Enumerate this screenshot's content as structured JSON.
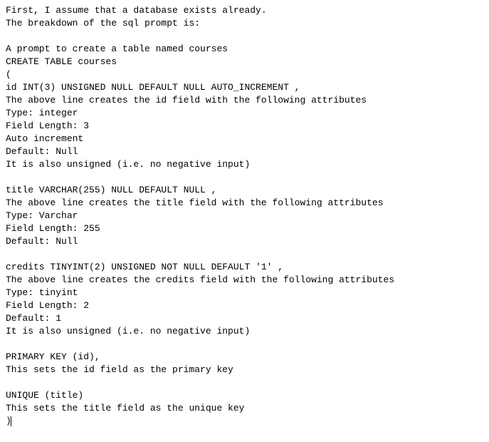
{
  "lines": [
    "First, I assume that a database exists already.",
    "The breakdown of the sql prompt is:",
    "",
    "A prompt to create a table named courses",
    "CREATE TABLE courses",
    "(",
    "id INT(3) UNSIGNED NULL DEFAULT NULL AUTO_INCREMENT ,",
    "The above line creates the id field with the following attributes",
    "Type: integer",
    "Field Length: 3",
    "Auto increment",
    "Default: Null",
    "It is also unsigned (i.e. no negative input)",
    "",
    "title VARCHAR(255) NULL DEFAULT NULL ,",
    "The above line creates the title field with the following attributes",
    "Type: Varchar",
    "Field Length: 255",
    "Default: Null",
    "",
    "credits TINYINT(2) UNSIGNED NOT NULL DEFAULT '1' ,",
    "The above line creates the credits field with the following attributes",
    "Type: tinyint",
    "Field Length: 2",
    "Default: 1",
    "It is also unsigned (i.e. no negative input)",
    "",
    "PRIMARY KEY (id),",
    "This sets the id field as the primary key",
    "",
    "UNIQUE (title)",
    "This sets the title field as the unique key",
    ")"
  ],
  "caret_after_last": true
}
